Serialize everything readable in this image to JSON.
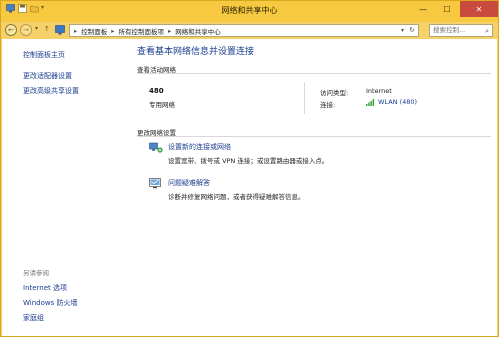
{
  "window": {
    "title": "网络和共享中心",
    "minimize": "—",
    "maximize": "☐",
    "close": "✕"
  },
  "nav": {
    "back": "←",
    "forward": "→",
    "dropdown": "▾",
    "up": "↑",
    "breadcrumbs": [
      "控制面板",
      "所有控制面板项",
      "网络和共享中心"
    ],
    "separator": "▸",
    "address_dropdown": "▾",
    "refresh": "↻",
    "search_placeholder": "搜索控制...",
    "search_icon": "⌕"
  },
  "sidebar": {
    "items": [
      {
        "label": "控制面板主页"
      },
      {
        "label": "更改适配器设置"
      },
      {
        "label": "更改高级共享设置"
      }
    ],
    "see_also_label": "另请参阅",
    "see_also": [
      {
        "label": "Internet 选项"
      },
      {
        "label": "Windows 防火墙"
      },
      {
        "label": "家庭组"
      }
    ]
  },
  "main": {
    "title": "查看基本网络信息并设置连接",
    "active_networks_label": "查看活动网络",
    "network": {
      "name": "480",
      "type": "专用网络",
      "access_type_label": "访问类型:",
      "access_type_value": "Internet",
      "connection_label": "连接:",
      "connection_value": "WLAN (480)"
    },
    "change_settings_label": "更改网络设置",
    "tasks": [
      {
        "title": "设置新的连接或网络",
        "desc": "设置宽带、拨号或 VPN 连接；或设置路由器或接入点。",
        "icon": "network-setup-icon"
      },
      {
        "title": "问题疑难解答",
        "desc": "诊断并修复网络问题，或者获得疑难解答信息。",
        "icon": "troubleshoot-icon"
      }
    ]
  },
  "colors": {
    "titlebar": "#f7c940",
    "link": "#1a3d8f",
    "close": "#c94b3d"
  }
}
